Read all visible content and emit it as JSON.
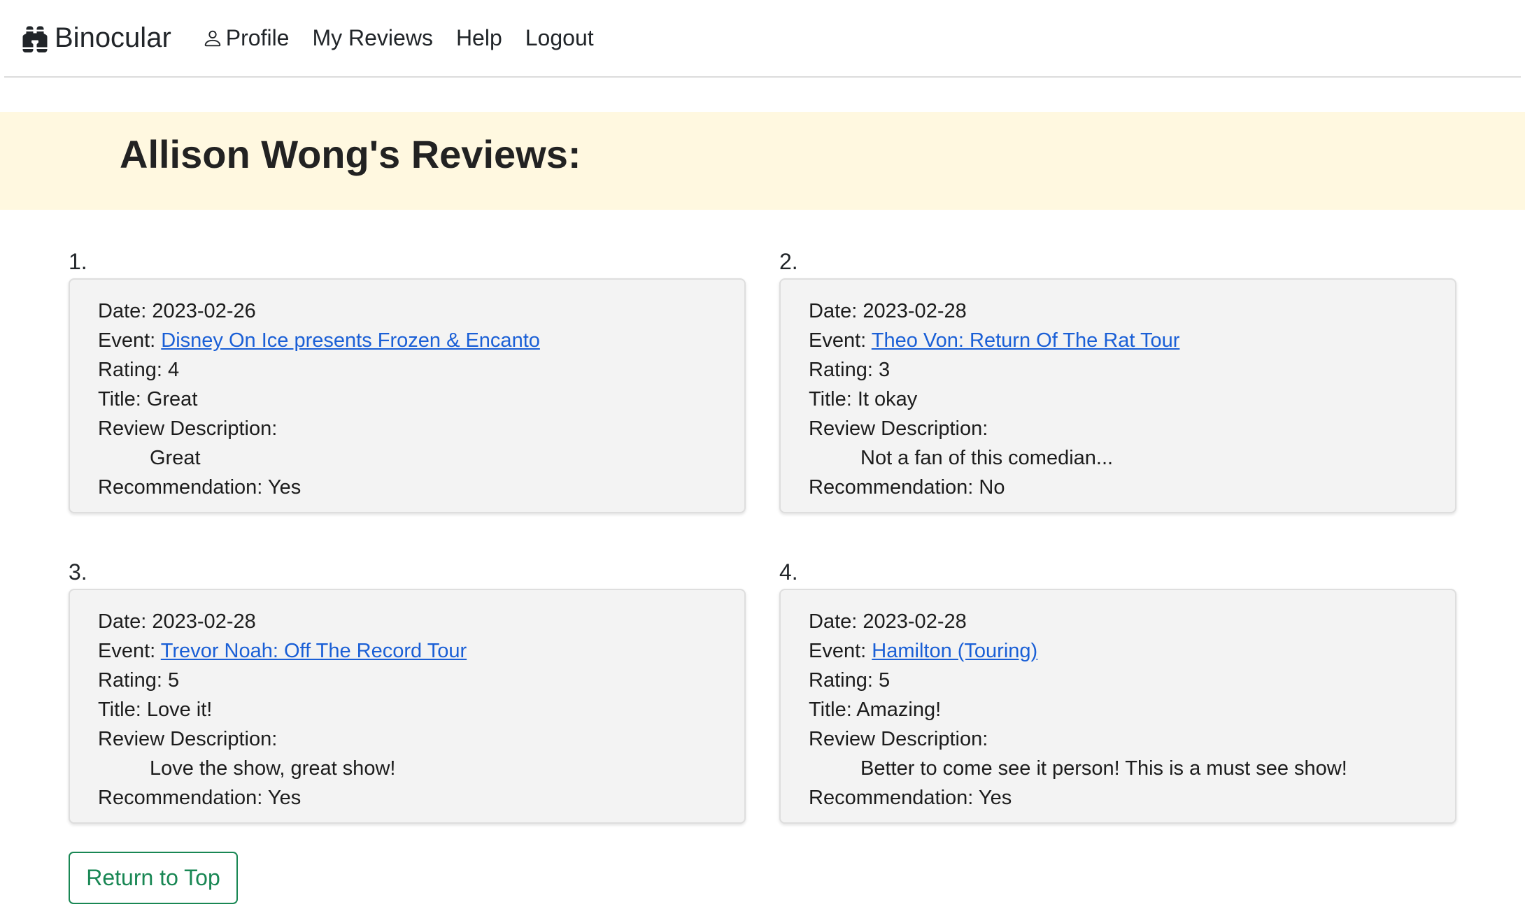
{
  "nav": {
    "brand": "Binocular",
    "items": [
      {
        "label": "Profile",
        "icon": "person-icon"
      },
      {
        "label": "My Reviews"
      },
      {
        "label": "Help"
      },
      {
        "label": "Logout"
      }
    ]
  },
  "page": {
    "title": "Allison Wong's Reviews:"
  },
  "labels": {
    "date": "Date:",
    "event": "Event:",
    "rating": "Rating:",
    "title": "Title:",
    "description": "Review Description:",
    "recommendation": "Recommendation:"
  },
  "reviews": [
    {
      "number": "1.",
      "date": "2023-02-26",
      "event": "Disney On Ice presents Frozen & Encanto",
      "rating": "4",
      "title": "Great",
      "description": "Great",
      "recommendation": "Yes"
    },
    {
      "number": "2.",
      "date": "2023-02-28",
      "event": "Theo Von: Return Of The Rat Tour",
      "rating": "3",
      "title": "It okay",
      "description": "Not a fan of this comedian...",
      "recommendation": "No"
    },
    {
      "number": "3.",
      "date": "2023-02-28",
      "event": "Trevor Noah: Off The Record Tour",
      "rating": "5",
      "title": "Love it!",
      "description": "Love the show, great show!",
      "recommendation": "Yes"
    },
    {
      "number": "4.",
      "date": "2023-02-28",
      "event": "Hamilton (Touring)",
      "rating": "5",
      "title": "Amazing!",
      "description": "Better to come see it person! This is a must see show!",
      "recommendation": "Yes"
    }
  ],
  "return_button": "Return to Top",
  "colors": {
    "banner": "#fff8e0",
    "link": "#1a5fd6",
    "button": "#198754"
  }
}
